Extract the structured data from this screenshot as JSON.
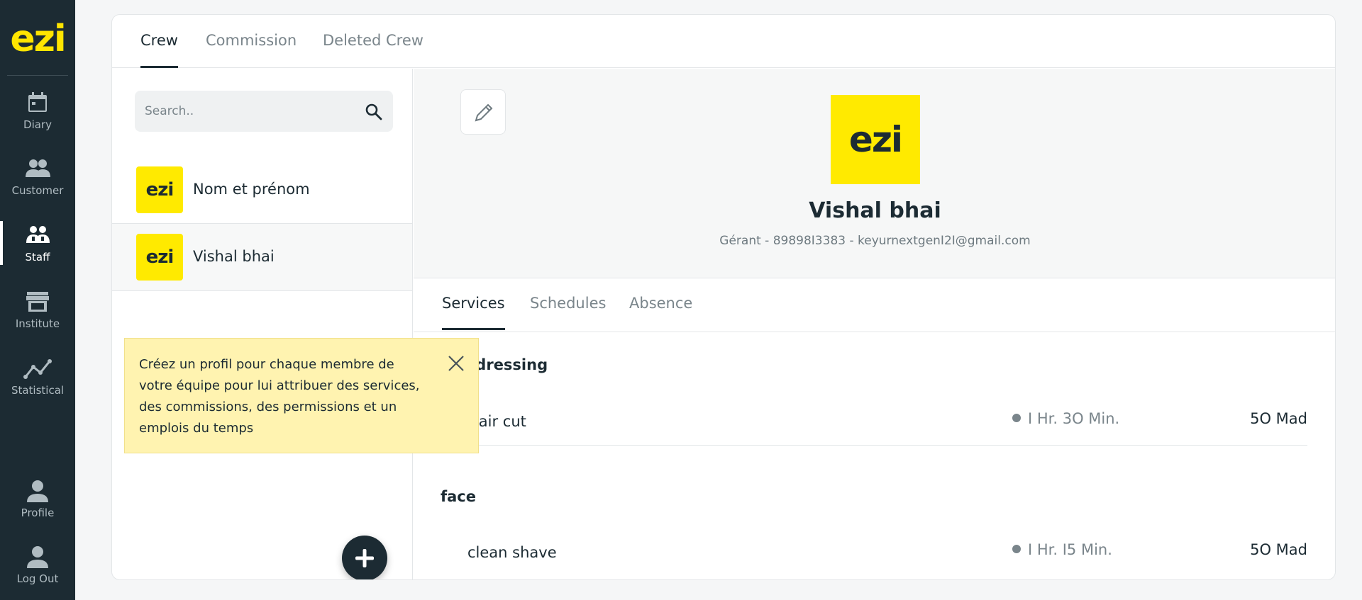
{
  "sidebar": {
    "logo": "ezi",
    "items": [
      {
        "label": "Diary",
        "icon": "calendar-icon"
      },
      {
        "label": "Customer",
        "icon": "customers-icon"
      },
      {
        "label": "Staff",
        "icon": "staff-icon",
        "active": true
      },
      {
        "label": "Institute",
        "icon": "store-icon"
      },
      {
        "label": "Statistical",
        "icon": "chart-icon"
      },
      {
        "label": "Profile",
        "icon": "person-icon"
      },
      {
        "label": "Log Out",
        "icon": "logout-person-icon"
      }
    ]
  },
  "top_tabs": [
    {
      "label": "Crew",
      "active": true
    },
    {
      "label": "Commission"
    },
    {
      "label": "Deleted Crew"
    }
  ],
  "search": {
    "placeholder": "Search.."
  },
  "crew": [
    {
      "avatar": "ezi",
      "name": "Nom et prénom"
    },
    {
      "avatar": "ezi",
      "name": "Vishal bhai",
      "selected": true
    }
  ],
  "tooltip": {
    "text": "Créez un profil pour chaque membre de votre équipe pour lui attribuer des services, des commissions, des permissions et un emplois du temps"
  },
  "profile": {
    "logo": "ezi",
    "name": "Vishal bhai",
    "meta": "Gérant - 89898I3383 - keyurnextgenI2I@gmail.com"
  },
  "sub_tabs": [
    {
      "label": "Services",
      "active": true
    },
    {
      "label": "Schedules"
    },
    {
      "label": "Absence"
    }
  ],
  "services": [
    {
      "category": "Hairdressing",
      "items": [
        {
          "name": "Hair cut",
          "duration": "I Hr. 3O Min.",
          "price": "5O Mad"
        }
      ]
    },
    {
      "category": "face",
      "items": [
        {
          "name": "clean shave",
          "duration": "I Hr. I5 Min.",
          "price": "5O Mad"
        }
      ]
    }
  ],
  "colors": {
    "brand_yellow": "#ffea00",
    "dark": "#1c2b33",
    "tooltip_bg": "#fff3b0"
  }
}
